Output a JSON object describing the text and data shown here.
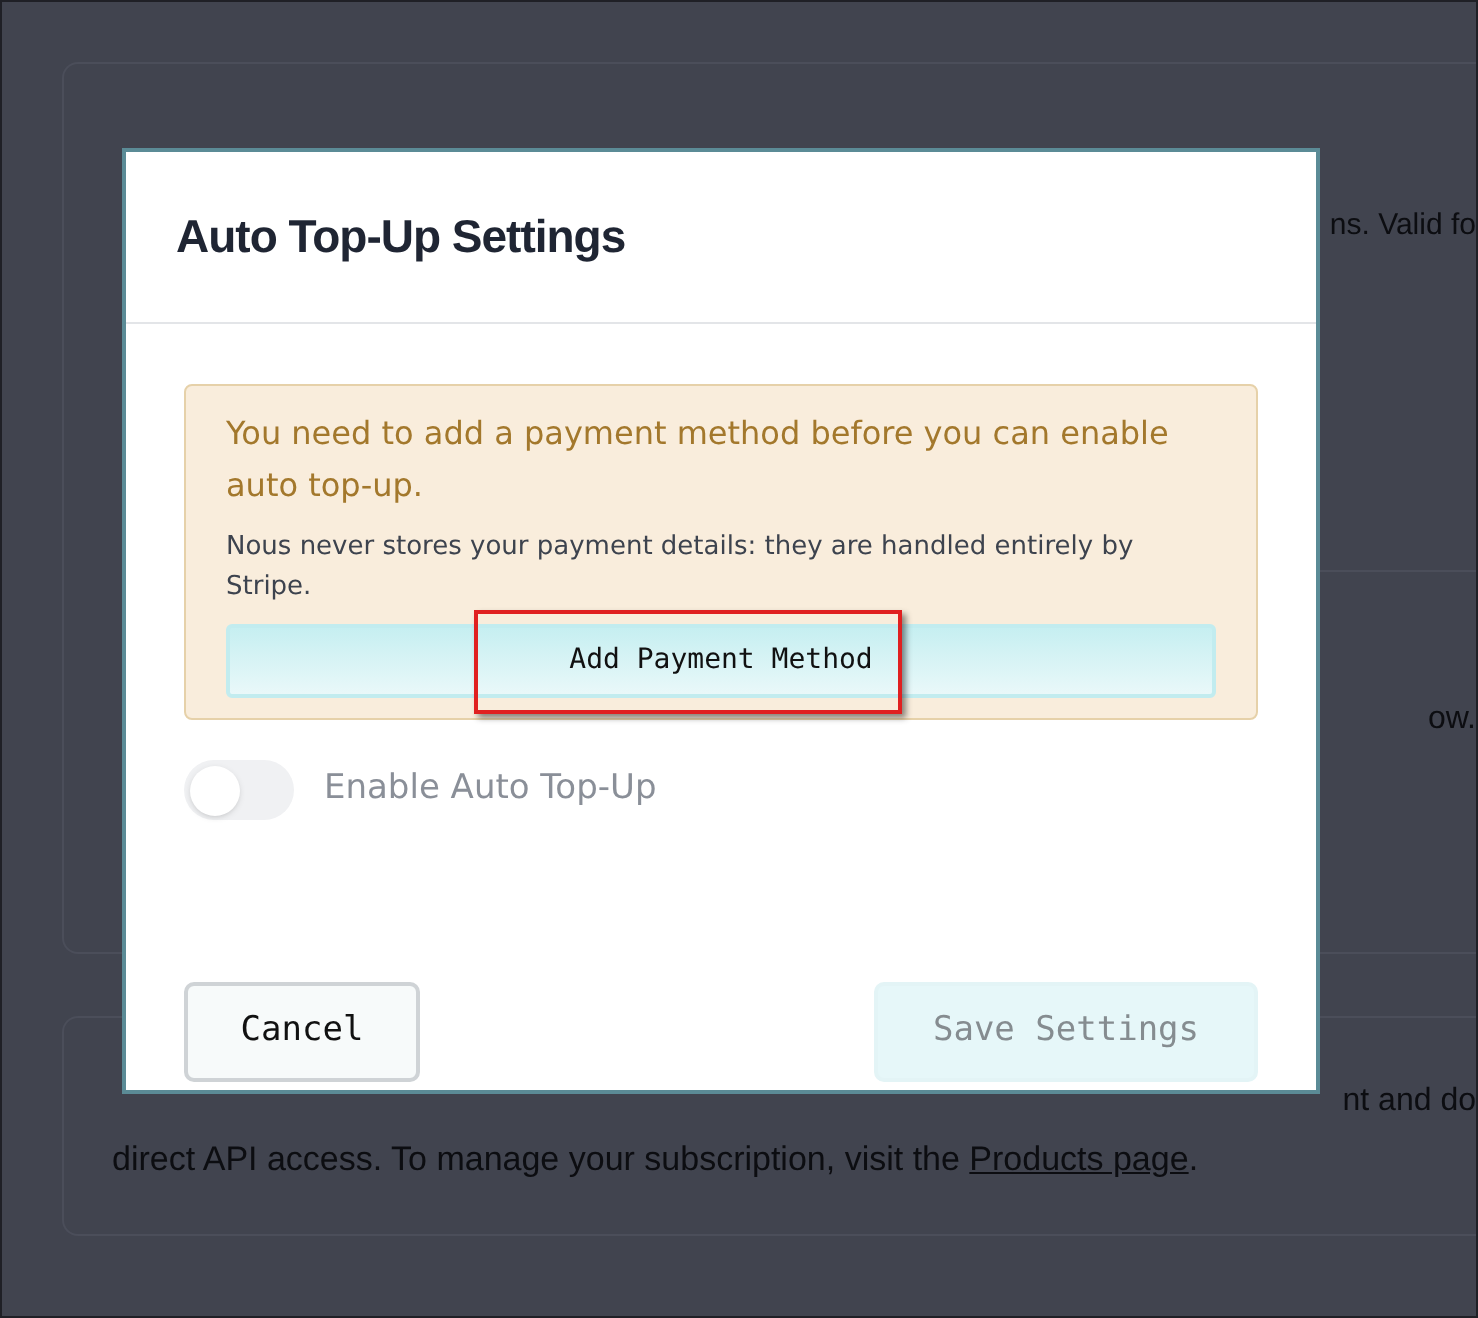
{
  "background": {
    "fragments": [
      {
        "kind": "top",
        "text": "ns. Valid fo"
      },
      {
        "kind": "middle",
        "text": "ow."
      },
      {
        "kind": "lower",
        "text": "nt and do"
      }
    ],
    "note": {
      "text": "direct API access. To manage your subscription, visit the ",
      "link": "Products page",
      "end": "."
    }
  },
  "dialog": {
    "title": "Auto Top-Up Settings",
    "alert": {
      "message": "You need to add a payment method before you can enable auto top-up.",
      "detail": "Nous never stores your payment details: they are handled entirely by Stripe.",
      "button": "Add Payment Method"
    },
    "toggle": {
      "label": "Enable Auto Top-Up",
      "on": false
    },
    "buttons": [
      {
        "label": "Cancel",
        "disabled": false
      },
      {
        "label": "Save Settings",
        "disabled": true
      }
    ]
  }
}
